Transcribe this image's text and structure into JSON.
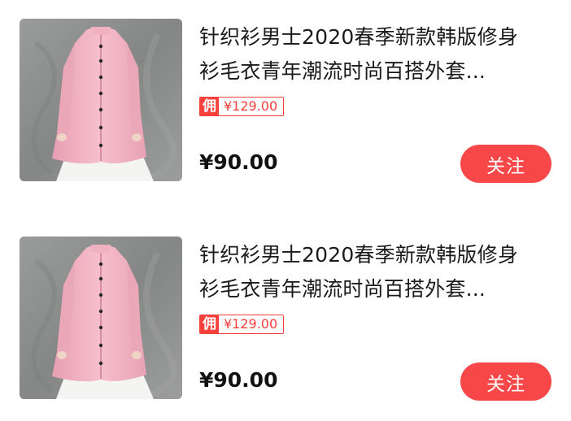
{
  "colors": {
    "accent_red": "#f84748",
    "commission_red": "#f5403b",
    "title_text": "#1a1a1a",
    "price_text": "#111111",
    "thumbnail_background": "#8b8c8c",
    "garment_pink": "#f3b4c4"
  },
  "products": [
    {
      "title_line_1": "针织衫男士2020春季新款韩版修身",
      "title_line_2": "衫毛衣青年潮流时尚百搭外套...",
      "commission_tag": "佣",
      "commission_value": "¥129.00",
      "price": "¥90.00",
      "follow_label": "关注"
    },
    {
      "title_line_1": "针织衫男士2020春季新款韩版修身",
      "title_line_2": "衫毛衣青年潮流时尚百搭外套...",
      "commission_tag": "佣",
      "commission_value": "¥129.00",
      "price": "¥90.00",
      "follow_label": "关注"
    }
  ]
}
